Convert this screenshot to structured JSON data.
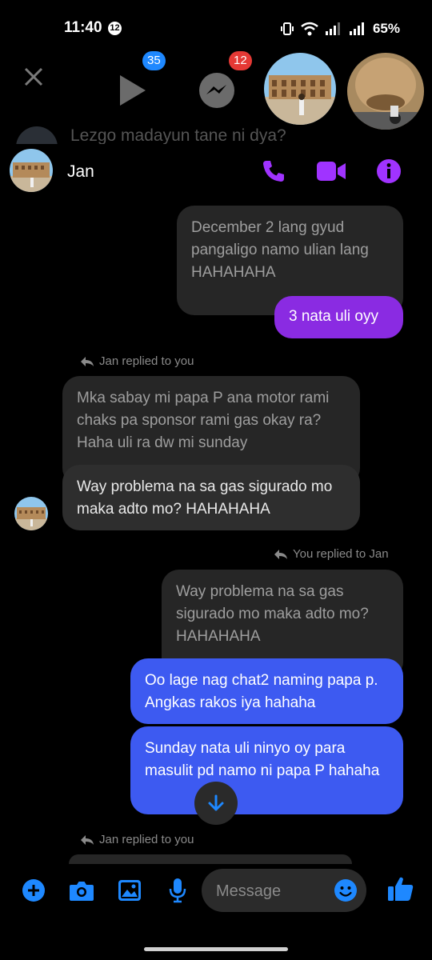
{
  "status_bar": {
    "time": "11:40",
    "notification_count": "12",
    "battery": "65%"
  },
  "bubble_bar": {
    "video_badge": "35",
    "messenger_badge": "12",
    "peek_text": "Lezgo madayun tane ni dya?"
  },
  "chat": {
    "contact_name": "Jan"
  },
  "messages": {
    "quoted_1": "December 2 lang gyud pangaligo namo ulian lang HAHAHAHA",
    "sent_1": "3 nata uli oyy",
    "reply_note_1": "Jan replied to you",
    "quoted_2": "Mka sabay mi papa P ana motor rami chaks pa sponsor rami gas okay ra? Haha uli ra dw mi sunday",
    "recv_1": "Way problema na sa gas sigurado mo maka adto mo? HAHAHAHA",
    "reply_note_2": "You replied to Jan",
    "quoted_3": "Way problema na sa gas sigurado mo maka adto mo? HAHAHAHA",
    "sent_2": "Oo lage nag chat2 naming papa p. Angkas rakos iya hahaha",
    "sent_3": "Sunday nata uli ninyo oy para masulit pd namo ni papa P hahaha",
    "reply_note_3": "Jan replied to you"
  },
  "composer": {
    "placeholder": "Message"
  },
  "colors": {
    "accent_purple": "#a033ff",
    "sent_purple": "#8a2be2",
    "sent_blue": "#3d5af1",
    "icon_blue": "#1e88ff"
  }
}
